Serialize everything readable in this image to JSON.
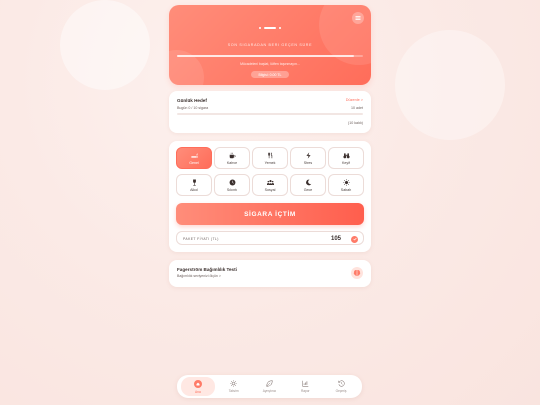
{
  "hero": {
    "timer_dashes": 3,
    "subtitle": "SON SIGARADAN BERI GEÇEN SÜRE",
    "progress": 0.95,
    "message": "Mücadeleni başlat, lütfen taşınmayın...",
    "chip": "Bilgisi: 0.00 TL"
  },
  "goal": {
    "title": "Günlük Hedef",
    "edit_label": "Düzenle >",
    "subtitle": "Bugün 0 / 10 sigara",
    "count": "10 adet",
    "progress": 0.0,
    "remaining": "(10 kaldı)"
  },
  "actions": {
    "tiles": [
      {
        "label": "Genel",
        "icon": "cigarette-icon",
        "active": true
      },
      {
        "label": "Kahve",
        "icon": "coffee-icon",
        "active": false
      },
      {
        "label": "Yemek",
        "icon": "utensils-icon",
        "active": false
      },
      {
        "label": "Stres",
        "icon": "lightning-icon",
        "active": false
      },
      {
        "label": "Keyif",
        "icon": "binoculars-icon",
        "active": false
      },
      {
        "label": "Alkol",
        "icon": "wine-icon",
        "active": false
      },
      {
        "label": "Sıkıntı",
        "icon": "clock-icon",
        "active": false
      },
      {
        "label": "Sosyal",
        "icon": "users-icon",
        "active": false
      },
      {
        "label": "Gece",
        "icon": "moon-icon",
        "active": false
      },
      {
        "label": "Sabah",
        "icon": "sun-icon",
        "active": false
      }
    ],
    "smoke_button": "SİGARA İÇTİM",
    "price_label": "PAKET FİYATI (TL)",
    "price_value": "105"
  },
  "fagerstrom": {
    "title": "Fagerström Bağımlılık Testi",
    "subtitle": "Bağımlılık seviyenizi ölçün >",
    "icon": "brain-icon"
  },
  "nav": {
    "items": [
      {
        "label": "Ana",
        "icon": "home-icon",
        "active": true
      },
      {
        "label": "Takvim",
        "icon": "sun-icon",
        "active": false
      },
      {
        "label": "Ayrıştırıcı",
        "icon": "leaf-icon",
        "active": false
      },
      {
        "label": "Rapor",
        "icon": "chart-icon",
        "active": false
      },
      {
        "label": "Geçmiş",
        "icon": "history-icon",
        "active": false
      }
    ]
  },
  "colors": {
    "accent": "#ff6d5a",
    "accent_light": "#ff8d7a",
    "background": "#fbeae6"
  }
}
